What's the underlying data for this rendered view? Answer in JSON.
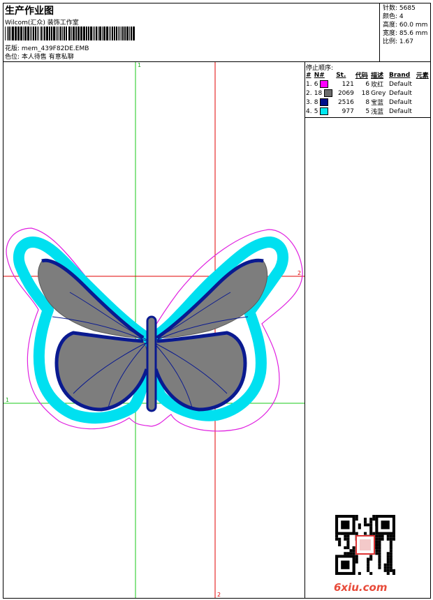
{
  "header": {
    "title": "生产作业图",
    "subtitle": "Wilcom(汇众) 装饰工作室",
    "design_label": "花版:",
    "design_name": "mem_439F82DE.EMB",
    "color_label": "色位:",
    "color_value": "本人待售 有意私聊"
  },
  "specs": [
    {
      "label": "针数",
      "value": "5685"
    },
    {
      "label": "颜色",
      "value": "4"
    },
    {
      "label": "高度",
      "value": "60.0 mm"
    },
    {
      "label": "宽度",
      "value": "85.6 mm"
    },
    {
      "label": "比例",
      "value": "1.67"
    }
  ],
  "stop_sequence": {
    "title": "停止顺序:",
    "headers": [
      "#",
      "N#",
      "St.",
      "代码",
      "描述",
      "Brand",
      "元素"
    ],
    "rows": [
      {
        "idx": "1.",
        "n": "6",
        "color": "#ff00ff",
        "st": "121",
        "code": "6",
        "desc": "玫红",
        "brand": "Default"
      },
      {
        "idx": "2.",
        "n": "18",
        "color": "#6b6b6b",
        "st": "2069",
        "code": "18",
        "desc": "Grey",
        "brand": "Default"
      },
      {
        "idx": "3.",
        "n": "8",
        "color": "#00108a",
        "st": "2516",
        "code": "8",
        "desc": "宝蓝",
        "brand": "Default"
      },
      {
        "idx": "4.",
        "n": "5",
        "color": "#00e8f0",
        "st": "977",
        "code": "5",
        "desc": "浅蓝",
        "brand": "Default"
      }
    ]
  },
  "axes": {
    "green": "1",
    "red": "2"
  },
  "watermark": "6xiu.com"
}
